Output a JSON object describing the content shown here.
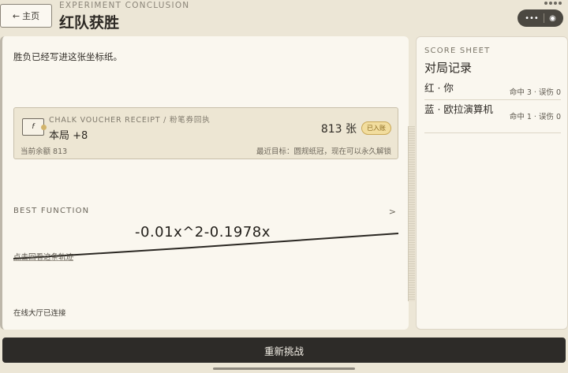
{
  "header": {
    "home_label": "主页",
    "eyebrow": "EXPERIMENT CONCLUSION",
    "title": "红队获胜"
  },
  "main": {
    "intro": "胜负已经写进这张坐标纸。",
    "receipt": {
      "heading": "CHALK VOUCHER RECEIPT / 粉笔券回执",
      "round_gain": "本局 +8",
      "amount": "813 张",
      "badge": "已入账",
      "balance": "当前余额 813",
      "target": "最近目标：圆规纸冠，现在可以永久解锁"
    },
    "best_function": {
      "label": "BEST FUNCTION",
      "formula": "-0.01x^2-0.1978x",
      "replay_link": "点击回看这条轨迹"
    },
    "lobby_status": "在线大厅已连接"
  },
  "score_sheet": {
    "eyebrow": "SCORE SHEET",
    "title": "对局记录",
    "rows": [
      {
        "name": "红 · 你",
        "stats": "命中 3 · 误伤 0"
      },
      {
        "name": "蓝 · 欧拉演算机",
        "stats": "命中 1 · 误伤 0"
      }
    ]
  },
  "footer": {
    "rematch_label": "重新挑战"
  },
  "icons": {
    "back": "arrow-left-icon",
    "receipt": "function-voucher-icon",
    "chevron": "chevron-right-icon",
    "capsule_more": "more-dots-icon",
    "capsule_close": "close-circle-icon"
  },
  "colors": {
    "background": "#ece6d6",
    "card": "#faf7ef",
    "button": "#2d2b28",
    "badge": "#f2dd9e"
  }
}
